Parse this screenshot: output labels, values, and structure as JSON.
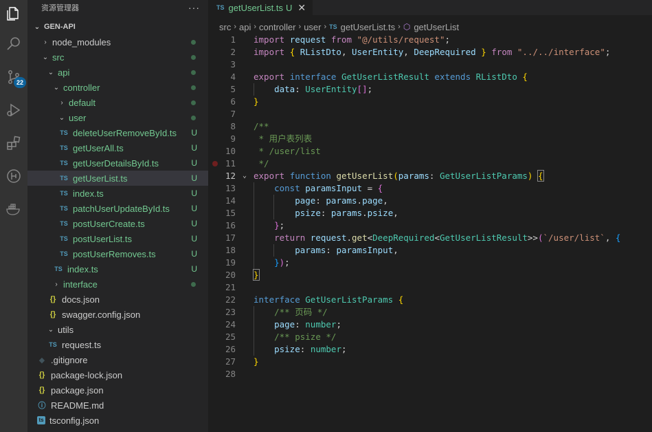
{
  "activity_bar": {
    "icons": [
      "explorer-icon",
      "search-icon",
      "source-control-icon",
      "run-debug-icon",
      "extensions-icon",
      "git-graph-icon",
      "docker-icon"
    ],
    "source_control_badge": "22"
  },
  "sidebar": {
    "title": "资源管理器",
    "more": "···",
    "root_folder": "GEN-API",
    "items": [
      {
        "label": "node_modules",
        "status": ""
      },
      {
        "label": "src",
        "status": ""
      },
      {
        "label": "api",
        "status": ""
      },
      {
        "label": "controller",
        "status": ""
      },
      {
        "label": "default",
        "status": ""
      },
      {
        "label": "user",
        "status": ""
      },
      {
        "label": "deleteUserRemoveById.ts",
        "status": "U"
      },
      {
        "label": "getUserAll.ts",
        "status": "U"
      },
      {
        "label": "getUserDetailsById.ts",
        "status": "U"
      },
      {
        "label": "getUserList.ts",
        "status": "U"
      },
      {
        "label": "index.ts",
        "status": "U"
      },
      {
        "label": "patchUserUpdateById.ts",
        "status": "U"
      },
      {
        "label": "postUserCreate.ts",
        "status": "U"
      },
      {
        "label": "postUserList.ts",
        "status": "U"
      },
      {
        "label": "postUserRemoves.ts",
        "status": "U"
      },
      {
        "label": "index.ts",
        "status": "U"
      },
      {
        "label": "interface",
        "status": ""
      },
      {
        "label": "docs.json",
        "status": ""
      },
      {
        "label": "swagger.config.json",
        "status": ""
      },
      {
        "label": "utils",
        "status": ""
      },
      {
        "label": "request.ts",
        "status": ""
      },
      {
        "label": ".gitignore",
        "status": ""
      },
      {
        "label": "package-lock.json",
        "status": ""
      },
      {
        "label": "package.json",
        "status": ""
      },
      {
        "label": "README.md",
        "status": ""
      },
      {
        "label": "tsconfig.json",
        "status": ""
      }
    ]
  },
  "editor": {
    "tab": {
      "icon_text": "TS",
      "name": "getUserList.ts",
      "status": "U",
      "close": "✕"
    },
    "breadcrumb": [
      "src",
      "api",
      "controller",
      "user",
      "getUserList.ts",
      "getUserList"
    ],
    "line_numbers": [
      "1",
      "2",
      "3",
      "4",
      "5",
      "6",
      "7",
      "8",
      "9",
      "10",
      "11",
      "12",
      "13",
      "14",
      "15",
      "16",
      "17",
      "18",
      "19",
      "20",
      "21",
      "22",
      "23",
      "24",
      "25",
      "26",
      "27",
      "28"
    ],
    "active_line": "12"
  }
}
